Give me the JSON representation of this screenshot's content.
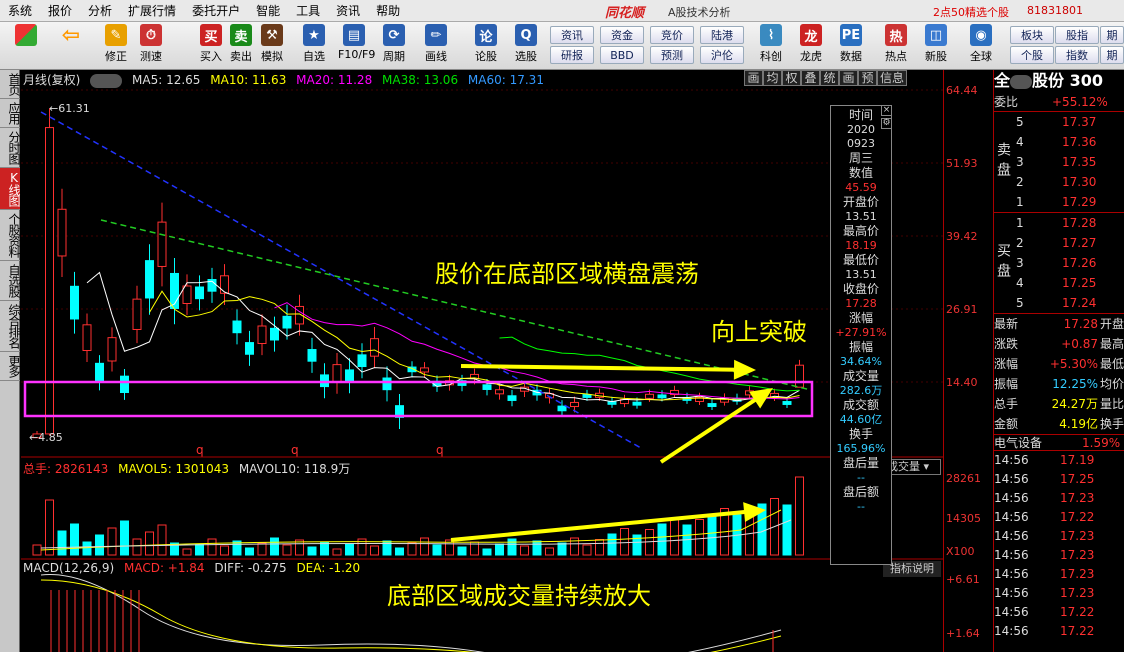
{
  "menu": [
    "系统",
    "报价",
    "分析",
    "扩展行情",
    "委托开户",
    "智能",
    "工具",
    "资讯",
    "帮助"
  ],
  "brand": "同花顺",
  "brand_sub": "A股技术分析",
  "promo": "2点50精选个股",
  "phone": "81831801",
  "toolbar": {
    "items": [
      "修正",
      "测速",
      "买入",
      "卖出",
      "模拟",
      "自选",
      "F10/F9",
      "周期",
      "画线",
      "论股",
      "选股",
      "科创",
      "龙虎",
      "数据",
      "热点",
      "新股",
      "全球"
    ],
    "links": [
      "资讯",
      "资金",
      "竞价",
      "陆港",
      "研报",
      "BBD",
      "预测",
      "沪伦",
      "板块",
      "股指",
      "期",
      "个股",
      "指数",
      "期"
    ]
  },
  "sidetabs": [
    "首页",
    "应用",
    "分时图",
    "K线图",
    "个股资料",
    "自选股",
    "综合排名",
    "更多"
  ],
  "chart_header": {
    "period": "月线(复权)",
    "ma5": "MA5: 12.65",
    "ma10": "MA10: 11.63",
    "ma20": "MA20: 11.28",
    "ma38": "MA38: 13.06",
    "ma60": "MA60: 17.31"
  },
  "chart_tools": [
    "画",
    "均",
    "权",
    "叠",
    "统",
    "画",
    "预",
    "信息"
  ],
  "high_label": "61.31",
  "low_label": "4.85",
  "q_marks": [
    "q",
    "q",
    "q"
  ],
  "vol_header": {
    "total": "总手: 2826143",
    "mavol5": "MAVOL5: 1301043",
    "mavol10": "MAVOL10: 118.9万"
  },
  "vol_selector": "成交量",
  "macd_header": {
    "name": "MACD(12,26,9)",
    "macd": "MACD: +1.84",
    "diff": "DIFF: -0.275",
    "dea": "DEA: -1.20"
  },
  "indicator_help": "指标说明",
  "price_ticks": [
    "64.44",
    "51.93",
    "39.42",
    "26.91",
    "14.40"
  ],
  "vol_ticks": [
    "28261",
    "14305",
    "X100"
  ],
  "macd_ticks": [
    "+6.61",
    "+1.64"
  ],
  "tooltip": {
    "time_label": "时间",
    "year": "2020",
    "date": "0923",
    "weekday": "周三",
    "value_label": "数值",
    "value": "45.59",
    "open_label": "开盘价",
    "open": "13.51",
    "high_label": "最高价",
    "high": "18.19",
    "low_label": "最低价",
    "low": "13.51",
    "close_label": "收盘价",
    "close": "17.28",
    "chg_label": "涨幅",
    "chg": "+27.91%",
    "amp_label": "振幅",
    "amp": "34.64%",
    "vol_label": "成交量",
    "vol": "282.6万",
    "amt_label": "成交额",
    "amt": "44.60亿",
    "turn_label": "换手",
    "turn": "165.96%",
    "post_vol_label": "盘后量",
    "post_vol": "--",
    "post_amt_label": "盘后额",
    "post_amt": "--"
  },
  "annotations": {
    "a1": "股价在底部区域横盘震荡",
    "a2": "向上突破",
    "a3": "底部区域成交量持续放大"
  },
  "quote": {
    "name": "全",
    "name2": "股份 300",
    "webi_label": "委比",
    "webi": "+55.12%",
    "sell_label": "卖盘",
    "buy_label": "买盘",
    "sells": [
      {
        "n": "5",
        "p": "17.37"
      },
      {
        "n": "4",
        "p": "17.36"
      },
      {
        "n": "3",
        "p": "17.35"
      },
      {
        "n": "2",
        "p": "17.30"
      },
      {
        "n": "1",
        "p": "17.29"
      }
    ],
    "buys": [
      {
        "n": "1",
        "p": "17.28"
      },
      {
        "n": "2",
        "p": "17.27"
      },
      {
        "n": "3",
        "p": "17.26"
      },
      {
        "n": "4",
        "p": "17.25"
      },
      {
        "n": "5",
        "p": "17.24"
      }
    ],
    "stats": [
      {
        "l": "最新",
        "v": "17.28",
        "r": "开盘"
      },
      {
        "l": "涨跌",
        "v": "+0.87",
        "r": "最高"
      },
      {
        "l": "涨幅",
        "v": "+5.30%",
        "r": "最低"
      },
      {
        "l": "振幅",
        "v": "12.25%",
        "r": "均价"
      },
      {
        "l": "总手",
        "v": "24.27万",
        "r": "量比"
      },
      {
        "l": "金额",
        "v": "4.19亿",
        "r": "换手"
      }
    ],
    "sector": "电气设备",
    "sector_chg": "1.59%",
    "ticks": [
      {
        "t": "14:56",
        "p": "17.19"
      },
      {
        "t": "14:56",
        "p": "17.25"
      },
      {
        "t": "14:56",
        "p": "17.23"
      },
      {
        "t": "14:56",
        "p": "17.22"
      },
      {
        "t": "14:56",
        "p": "17.23"
      },
      {
        "t": "14:56",
        "p": "17.23"
      },
      {
        "t": "14:56",
        "p": "17.23"
      },
      {
        "t": "14:56",
        "p": "17.23"
      },
      {
        "t": "14:56",
        "p": "17.22"
      },
      {
        "t": "14:56",
        "p": "17.22"
      }
    ]
  },
  "colors": {
    "up": "#ff3030",
    "down": "#00ffff",
    "ma5": "#ffffff",
    "ma10": "#ffff00",
    "ma20": "#ff00ff",
    "ma38": "#00ff00",
    "ma60": "#3399ff",
    "box": "#ff33ff",
    "arrow": "#ffff00"
  }
}
